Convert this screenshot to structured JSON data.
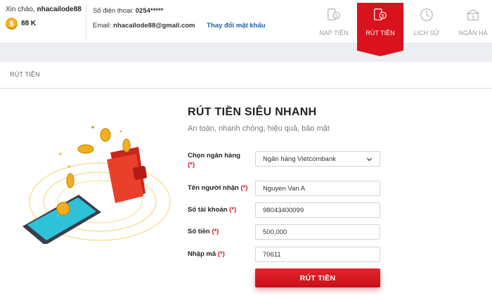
{
  "account": {
    "greeting": "Xin chào,",
    "username": "nhacailode88",
    "balance": "88 K",
    "coin_symbol": "$",
    "phone_label": "Số điện thoại:",
    "phone_value": "0254*****",
    "email_label": "Email:",
    "email_value": "nhacailode88@gmail.com",
    "change_password": "Thay đổi mật khẩu"
  },
  "nav": {
    "items": [
      {
        "label": "NẠP TIỀN",
        "icon": "deposit-icon",
        "active": false
      },
      {
        "label": "RÚT TIỀN",
        "icon": "withdraw-icon",
        "active": true
      },
      {
        "label": "LỊCH SỬ",
        "icon": "history-clock-icon",
        "active": false
      },
      {
        "label": "NGÂN HÀ",
        "icon": "bank-icon",
        "active": false
      }
    ]
  },
  "section": {
    "title": "RÚT TIỀN"
  },
  "form": {
    "title": "RÚT TIỀN SIÊU NHANH",
    "subtitle": "An toàn, nhanh chóng, hiệu quả, bảo mật",
    "required_mark": "(*)",
    "bank": {
      "label": "Chọn ngân hàng",
      "value": "Ngân hàng Vietcombank"
    },
    "recipient": {
      "label": "Tên người nhận",
      "value": "Nguyen Van A"
    },
    "account_number": {
      "label": "Số tài khoản",
      "value": "98043400099"
    },
    "amount": {
      "label": "Số tiền",
      "value": "500,000"
    },
    "code": {
      "label": "Nhập mã",
      "value": "70611"
    },
    "submit_label": "RÚT TIỀN"
  },
  "colors": {
    "brand_red": "#d9121d",
    "link_blue": "#1a5fb4",
    "coin_gold": "#f2b020"
  }
}
